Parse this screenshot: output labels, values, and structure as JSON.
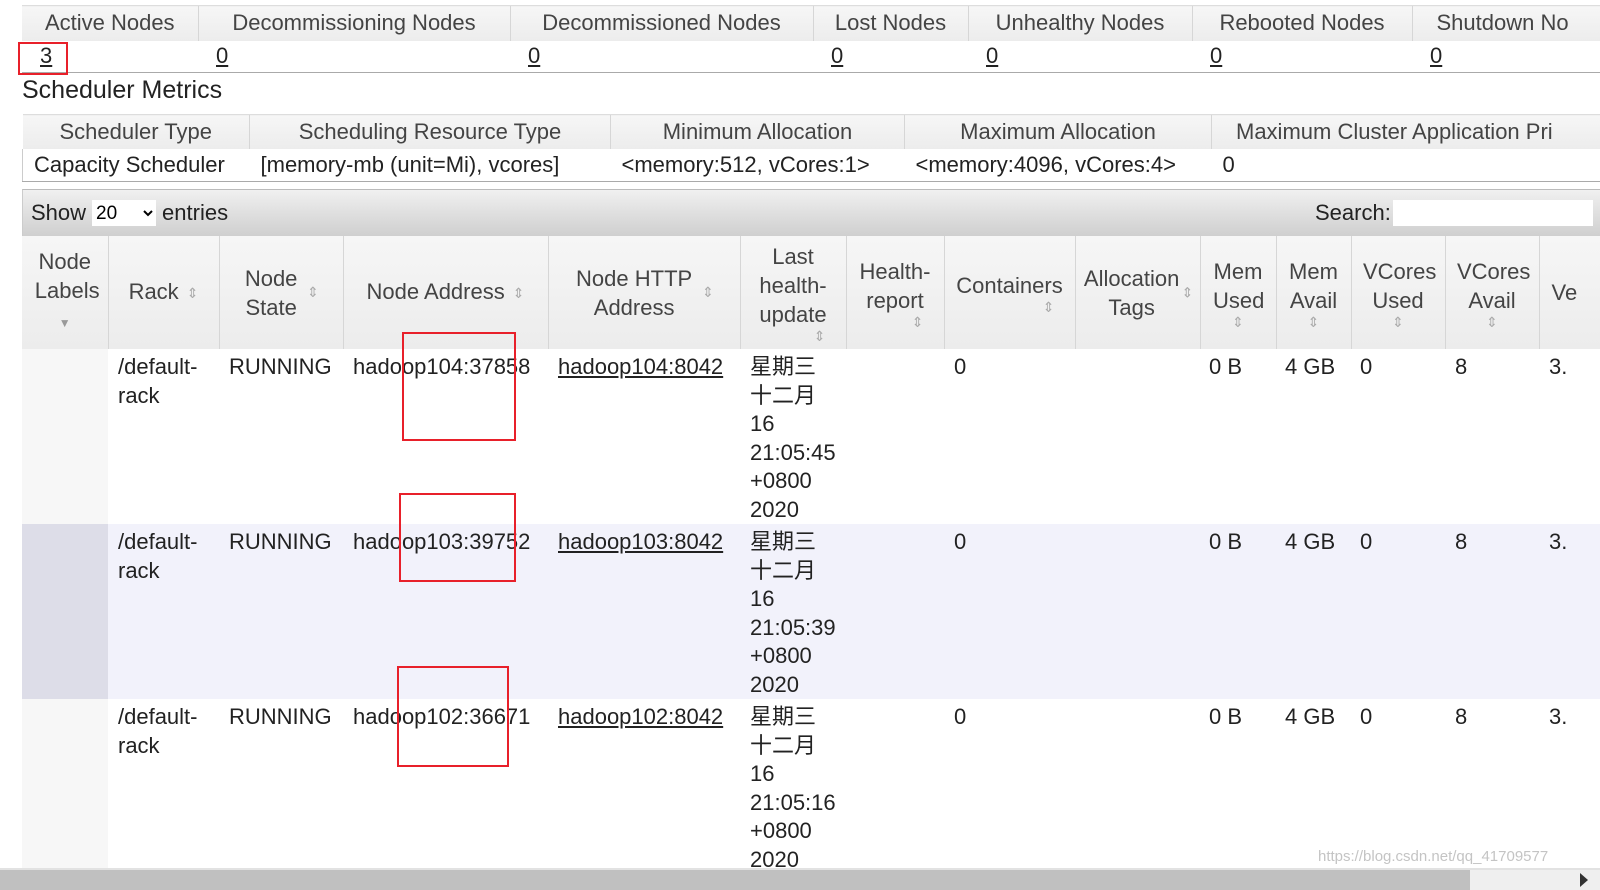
{
  "summary": {
    "headers": [
      "Active Nodes",
      "Decommissioning Nodes",
      "Decommissioned Nodes",
      "Lost Nodes",
      "Unhealthy Nodes",
      "Rebooted Nodes",
      "Shutdown No"
    ],
    "values": [
      "3",
      "0",
      "0",
      "0",
      "0",
      "0",
      "0"
    ]
  },
  "scheduler": {
    "title": "Scheduler Metrics",
    "headers": [
      "Scheduler Type",
      "Scheduling Resource Type",
      "Minimum Allocation",
      "Maximum Allocation",
      "Maximum Cluster Application Pri"
    ],
    "values": [
      "Capacity Scheduler",
      "[memory-mb (unit=Mi), vcores]",
      "<memory:512, vCores:1>",
      "<memory:4096, vCores:4>",
      "0"
    ]
  },
  "toolbar": {
    "show": "Show",
    "entries": "entries",
    "page_size": "20",
    "search_label": "Search:",
    "search_value": ""
  },
  "nodes": {
    "headers": [
      "Node Labels",
      "Rack",
      "Node State",
      "Node Address",
      "Node HTTP Address",
      "Last health-update",
      "Health-report",
      "Containers",
      "Allocation Tags",
      "Mem Used",
      "Mem Avail",
      "VCores Used",
      "VCores Avail",
      "Ve"
    ],
    "rows": [
      {
        "labels": "",
        "rack": "/default-rack",
        "state": "RUNNING",
        "address": "hadoop104:37858",
        "http": "hadoop104:8042",
        "last_update": "星期三 十二月 16 21:05:45 +0800 2020",
        "health": "",
        "containers": "0",
        "tags": "",
        "mem_used": "0 B",
        "mem_avail": "4 GB",
        "vcores_used": "0",
        "vcores_avail": "8",
        "version": "3."
      },
      {
        "labels": "",
        "rack": "/default-rack",
        "state": "RUNNING",
        "address": "hadoop103:39752",
        "http": "hadoop103:8042",
        "last_update": "星期三 十二月 16 21:05:39 +0800 2020",
        "health": "",
        "containers": "0",
        "tags": "",
        "mem_used": "0 B",
        "mem_avail": "4 GB",
        "vcores_used": "0",
        "vcores_avail": "8",
        "version": "3."
      },
      {
        "labels": "",
        "rack": "/default-rack",
        "state": "RUNNING",
        "address": "hadoop102:36671",
        "http": "hadoop102:8042",
        "last_update": "星期三 十二月 16 21:05:16 +0800 2020",
        "health": "",
        "containers": "0",
        "tags": "",
        "mem_used": "0 B",
        "mem_avail": "4 GB",
        "vcores_used": "0",
        "vcores_avail": "8",
        "version": "3."
      }
    ]
  },
  "watermark": "https://blog.csdn.net/qq_41709577",
  "colors": {
    "annotation": "#e8202a",
    "alt_row": "#f2f2fb"
  }
}
